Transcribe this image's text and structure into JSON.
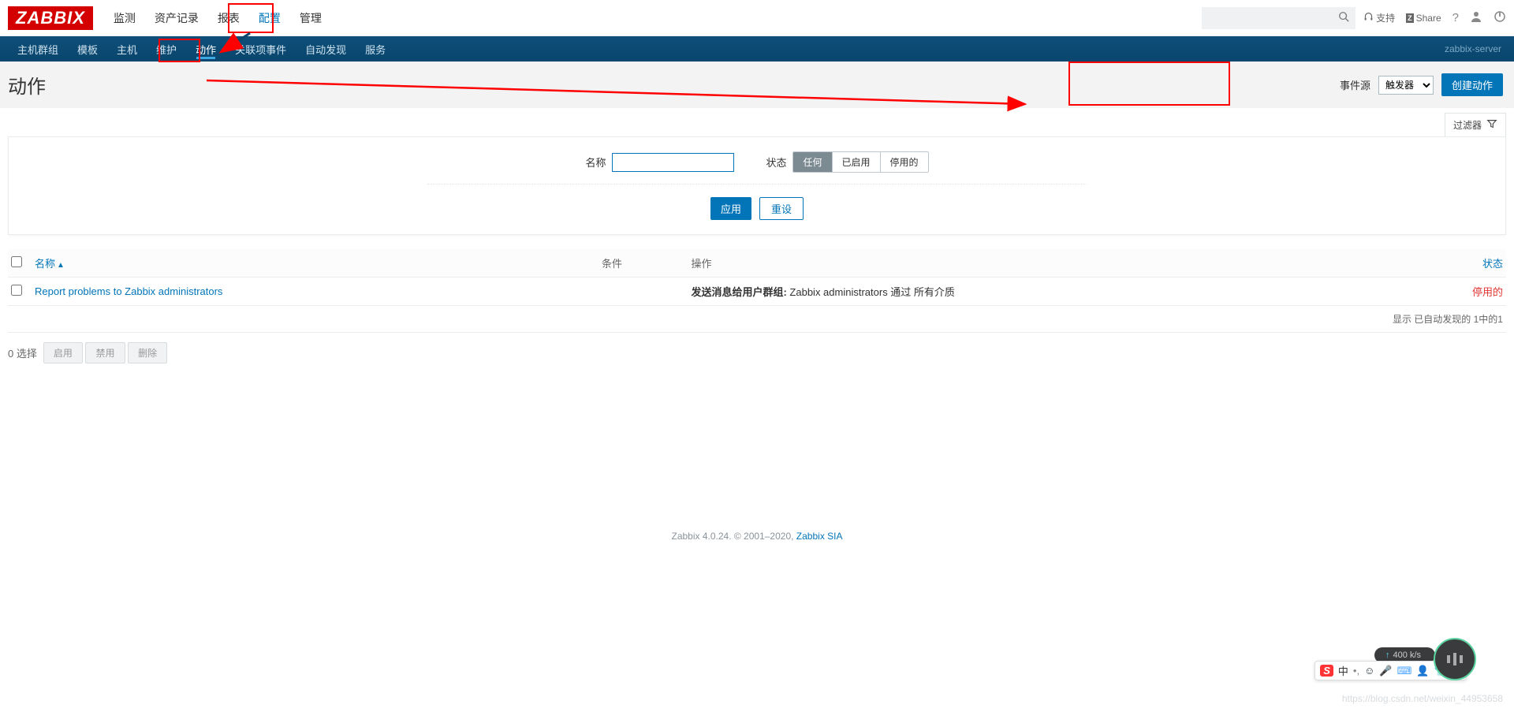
{
  "logo": "ZABBIX",
  "topnav": [
    "监测",
    "资产记录",
    "报表",
    "配置",
    "管理"
  ],
  "topnav_active_index": 3,
  "top_search_placeholder": "",
  "top_support": "支持",
  "top_share": "Share",
  "subnav": [
    "主机群组",
    "模板",
    "主机",
    "维护",
    "动作",
    "关联项事件",
    "自动发现",
    "服务"
  ],
  "subnav_active_index": 4,
  "server_name": "zabbix-server",
  "page_title": "动作",
  "event_source_label": "事件源",
  "event_source_selected": "触发器",
  "create_action_btn": "创建动作",
  "filter_toggle": "过滤器",
  "filter_name_label": "名称",
  "filter_name_value": "",
  "filter_status_label": "状态",
  "filter_status_options": [
    "任何",
    "已启用",
    "停用的"
  ],
  "filter_status_selected_index": 0,
  "apply_btn": "应用",
  "reset_btn": "重设",
  "columns": {
    "name": "名称",
    "conditions": "条件",
    "operations": "操作",
    "status": "状态"
  },
  "rows": [
    {
      "name": "Report problems to Zabbix administrators",
      "conditions": "",
      "operation_bold": "发送消息给用户群组:",
      "operation_rest": " Zabbix administrators 通过 所有介质",
      "status": "停用的",
      "status_disabled": true
    }
  ],
  "list_footer": "显示 已自动发现的 1中的1",
  "selected_count_label": "0 选择",
  "bulk_buttons": [
    "启用",
    "禁用",
    "删除"
  ],
  "footer_text": "Zabbix 4.0.24. © 2001–2020, ",
  "footer_link": "Zabbix SIA",
  "watermark": "https://blog.csdn.net/weixin_44953658",
  "ime": {
    "zhong": "中",
    "speed": "400 k/s"
  }
}
